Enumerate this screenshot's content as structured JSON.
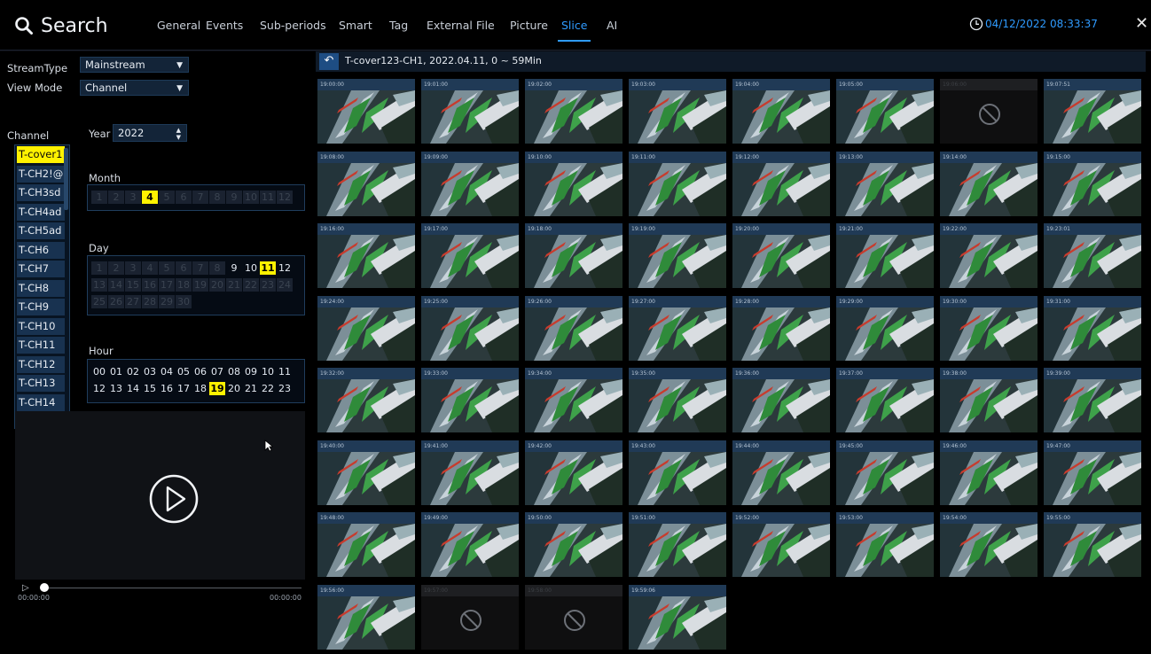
{
  "header": {
    "title": "Search",
    "tabs": [
      "General",
      "Events",
      "Sub-periods",
      "Smart",
      "Tag",
      "External File",
      "Picture",
      "Slice",
      "AI"
    ],
    "active_tab": "Slice",
    "datetime": "04/12/2022 08:33:37",
    "close": "✕"
  },
  "filters": {
    "stream_type_label": "StreamType",
    "stream_type_value": "Mainstream",
    "view_mode_label": "View Mode",
    "view_mode_value": "Channel",
    "channel_label": "Channel",
    "year_label": "Year",
    "year_value": "2022",
    "month_label": "Month",
    "day_label": "Day",
    "hour_label": "Hour"
  },
  "channels": [
    "T-cover1",
    "T-CH2!@",
    "T-CH3sd",
    "T-CH4ad",
    "T-CH5ad",
    "T-CH6",
    "T-CH7",
    "T-CH8",
    "T-CH9",
    "T-CH10",
    "T-CH11",
    "T-CH12",
    "T-CH13",
    "T-CH14"
  ],
  "selected_channel": "T-cover1",
  "months": {
    "values": [
      "1",
      "2",
      "3",
      "4",
      "5",
      "6",
      "7",
      "8",
      "9",
      "10",
      "11",
      "12"
    ],
    "enabled": [
      "4"
    ],
    "selected": "4"
  },
  "days": {
    "values": [
      "1",
      "2",
      "3",
      "4",
      "5",
      "6",
      "7",
      "8",
      "9",
      "10",
      "11",
      "12",
      "13",
      "14",
      "15",
      "16",
      "17",
      "18",
      "19",
      "20",
      "21",
      "22",
      "23",
      "24",
      "25",
      "26",
      "27",
      "28",
      "29",
      "30"
    ],
    "enabled": [
      "9",
      "10",
      "11",
      "12"
    ],
    "selected": "11"
  },
  "hours": {
    "values": [
      "00",
      "01",
      "02",
      "03",
      "04",
      "05",
      "06",
      "07",
      "08",
      "09",
      "10",
      "11",
      "12",
      "13",
      "14",
      "15",
      "16",
      "17",
      "18",
      "19",
      "20",
      "21",
      "22",
      "23"
    ],
    "selected": "19"
  },
  "player": {
    "time_start": "00:00:00",
    "time_end": "00:00:00"
  },
  "slice_header": "T-cover123-CH1,  2022.04.11,  0 ~ 59Min",
  "thumbnails": [
    {
      "time": "19:00:00",
      "empty": false
    },
    {
      "time": "19:01:00",
      "empty": false
    },
    {
      "time": "19:02:00",
      "empty": false
    },
    {
      "time": "19:03:00",
      "empty": false
    },
    {
      "time": "19:04:00",
      "empty": false
    },
    {
      "time": "19:05:00",
      "empty": false
    },
    {
      "time": "19:06:00",
      "empty": true
    },
    {
      "time": "19:07:51",
      "empty": false
    },
    {
      "time": "19:08:00",
      "empty": false
    },
    {
      "time": "19:09:00",
      "empty": false
    },
    {
      "time": "19:10:00",
      "empty": false
    },
    {
      "time": "19:11:00",
      "empty": false
    },
    {
      "time": "19:12:00",
      "empty": false
    },
    {
      "time": "19:13:00",
      "empty": false
    },
    {
      "time": "19:14:00",
      "empty": false
    },
    {
      "time": "19:15:00",
      "empty": false
    },
    {
      "time": "19:16:00",
      "empty": false
    },
    {
      "time": "19:17:00",
      "empty": false
    },
    {
      "time": "19:18:00",
      "empty": false
    },
    {
      "time": "19:19:00",
      "empty": false
    },
    {
      "time": "19:20:00",
      "empty": false
    },
    {
      "time": "19:21:00",
      "empty": false
    },
    {
      "time": "19:22:00",
      "empty": false
    },
    {
      "time": "19:23:01",
      "empty": false
    },
    {
      "time": "19:24:00",
      "empty": false
    },
    {
      "time": "19:25:00",
      "empty": false
    },
    {
      "time": "19:26:00",
      "empty": false
    },
    {
      "time": "19:27:00",
      "empty": false
    },
    {
      "time": "19:28:00",
      "empty": false
    },
    {
      "time": "19:29:00",
      "empty": false
    },
    {
      "time": "19:30:00",
      "empty": false
    },
    {
      "time": "19:31:00",
      "empty": false
    },
    {
      "time": "19:32:00",
      "empty": false
    },
    {
      "time": "19:33:00",
      "empty": false
    },
    {
      "time": "19:34:00",
      "empty": false
    },
    {
      "time": "19:35:00",
      "empty": false
    },
    {
      "time": "19:36:00",
      "empty": false
    },
    {
      "time": "19:37:00",
      "empty": false
    },
    {
      "time": "19:38:00",
      "empty": false
    },
    {
      "time": "19:39:00",
      "empty": false
    },
    {
      "time": "19:40:00",
      "empty": false
    },
    {
      "time": "19:41:00",
      "empty": false
    },
    {
      "time": "19:42:00",
      "empty": false
    },
    {
      "time": "19:43:00",
      "empty": false
    },
    {
      "time": "19:44:00",
      "empty": false
    },
    {
      "time": "19:45:00",
      "empty": false
    },
    {
      "time": "19:46:00",
      "empty": false
    },
    {
      "time": "19:47:00",
      "empty": false
    },
    {
      "time": "19:48:00",
      "empty": false
    },
    {
      "time": "19:49:00",
      "empty": false
    },
    {
      "time": "19:50:00",
      "empty": false
    },
    {
      "time": "19:51:00",
      "empty": false
    },
    {
      "time": "19:52:00",
      "empty": false
    },
    {
      "time": "19:53:00",
      "empty": false
    },
    {
      "time": "19:54:00",
      "empty": false
    },
    {
      "time": "19:55:00",
      "empty": false
    },
    {
      "time": "19:56:00",
      "empty": false
    },
    {
      "time": "19:57:00",
      "empty": true
    },
    {
      "time": "19:58:00",
      "empty": true
    },
    {
      "time": "19:59:06",
      "empty": false
    }
  ]
}
